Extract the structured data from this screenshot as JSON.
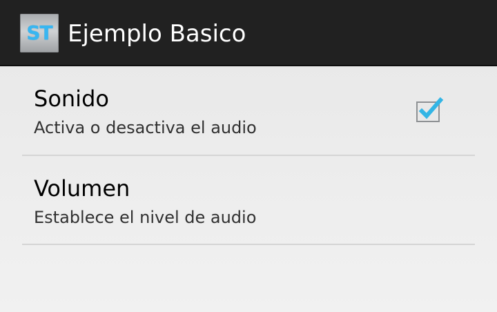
{
  "app": {
    "icon_text": "ST",
    "title": "Ejemplo Basico"
  },
  "preferences": [
    {
      "title": "Sonido",
      "summary": "Activa o desactiva el audio",
      "checked": true
    },
    {
      "title": "Volumen",
      "summary": "Establece el nivel de audio"
    }
  ],
  "colors": {
    "action_bar": "#212121",
    "accent": "#33b5e5",
    "background": "#ececec",
    "divider": "#d4d4d4"
  },
  "icons": {
    "app": "app-logo-icon",
    "checkbox": "checkbox-checked-icon"
  }
}
